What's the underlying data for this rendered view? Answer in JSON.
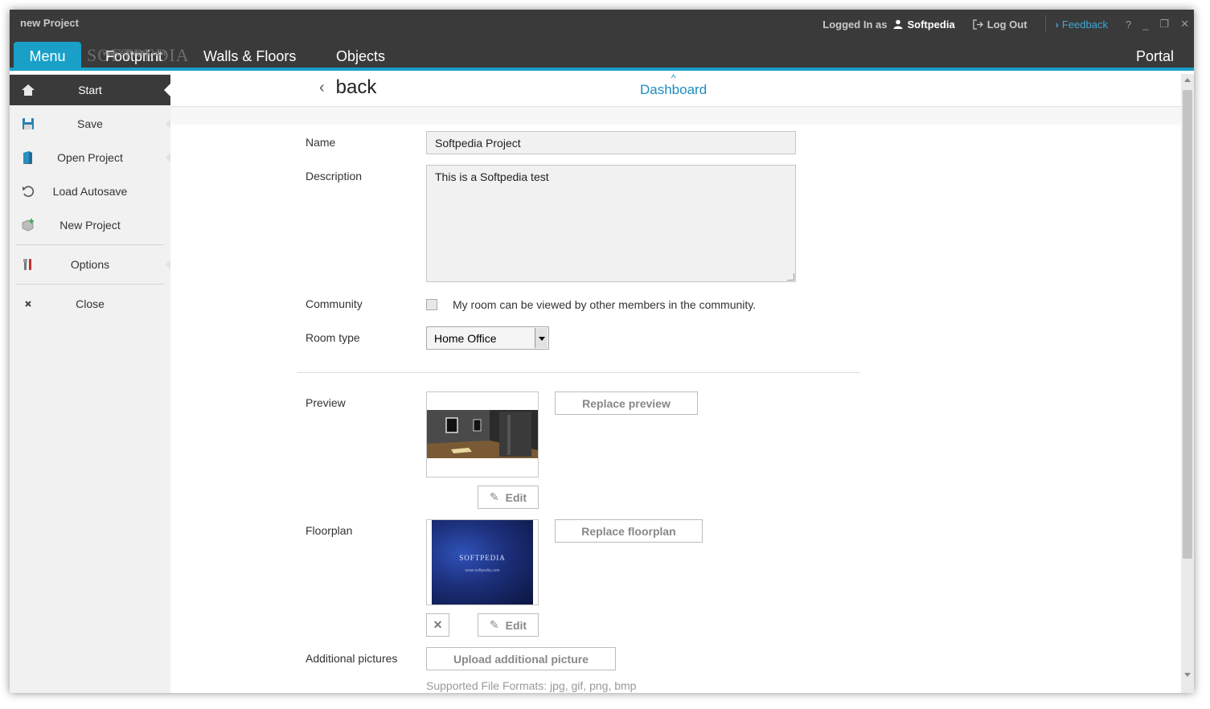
{
  "window": {
    "title": "new Project"
  },
  "titlebar": {
    "logged_in_label": "Logged In as",
    "user_name": "Softpedia",
    "logout_label": "Log Out",
    "feedback_label": "Feedback",
    "help_label": "?"
  },
  "nav": {
    "menu_label": "Menu",
    "tabs": [
      "Footprint",
      "Walls & Floors",
      "Objects"
    ],
    "portal_label": "Portal",
    "watermark": "SOFTPEDIA",
    "watermark_url": "www.softpedia.com"
  },
  "sidebar": {
    "items": [
      {
        "label": "Start",
        "icon": "home-icon"
      },
      {
        "label": "Save",
        "icon": "floppy-icon"
      },
      {
        "label": "Open Project",
        "icon": "folder-icon"
      },
      {
        "label": "Load Autosave",
        "icon": "undo-icon"
      },
      {
        "label": "New Project",
        "icon": "new-project-icon"
      },
      {
        "label": "Options",
        "icon": "tools-icon"
      },
      {
        "label": "Close",
        "icon": "close-icon"
      }
    ]
  },
  "header": {
    "back_label": "back",
    "dashboard_label": "Dashboard"
  },
  "form": {
    "name_label": "Name",
    "name_value": "Softpedia Project",
    "description_label": "Description",
    "description_value": "This is a Softpedia test",
    "community_label": "Community",
    "community_checkbox_label": "My room can be viewed by other members in the community.",
    "community_checked": false,
    "room_type_label": "Room type",
    "room_type_value": "Home Office",
    "preview_label": "Preview",
    "replace_preview_label": "Replace preview",
    "edit_label": "Edit",
    "floorplan_label": "Floorplan",
    "replace_floorplan_label": "Replace floorplan",
    "floorplan_image_text": "SOFTPEDIA",
    "floorplan_image_url": "www.softpedia.com",
    "additional_pictures_label": "Additional pictures",
    "upload_label": "Upload additional picture",
    "formats_label": "Supported File Formats: jpg, gif, png, bmp"
  },
  "colors": {
    "accent": "#1aa0c8",
    "dark": "#3a3a3a",
    "link": "#1a8fbf"
  }
}
